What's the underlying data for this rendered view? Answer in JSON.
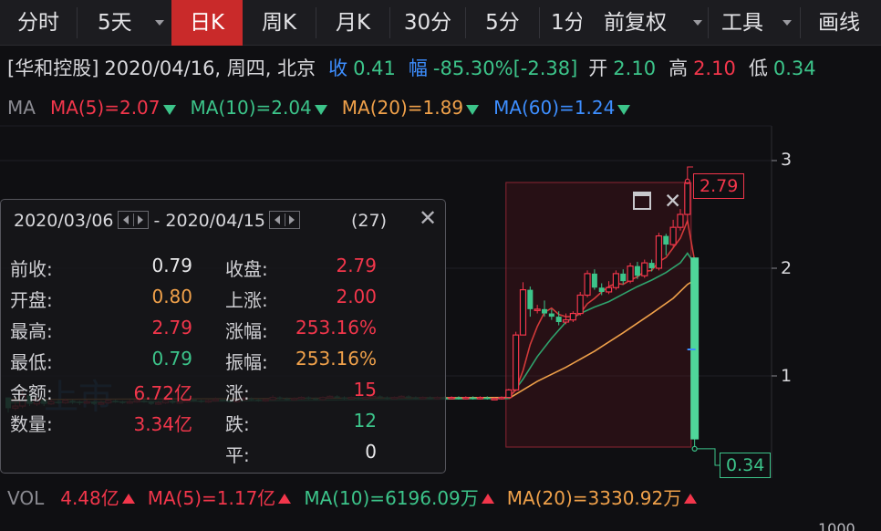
{
  "toolbar": {
    "buttons": [
      "分时",
      "5天",
      "日K",
      "周K",
      "月K",
      "30分",
      "5分",
      "1分",
      "前复权",
      "工具",
      "画线"
    ],
    "active": "日K"
  },
  "info": {
    "name": "[华和控股]",
    "datetime": "2020/04/16, 周四, 北京",
    "close_label": "收",
    "close_value": "0.41",
    "change_label": "幅",
    "change_value": "-85.30%",
    "change_abs": "[-2.38]",
    "open_label": "开",
    "open_value": "2.10",
    "high_label": "高",
    "high_value": "2.10",
    "low_label": "低",
    "low_value": "0.34"
  },
  "ma": {
    "label": "MA",
    "ma5": "MA(5)=2.07",
    "ma10": "MA(10)=2.04",
    "ma20": "MA(20)=1.89",
    "ma60": "MA(60)=1.24"
  },
  "popup": {
    "date_from": "2020/03/06",
    "date_to": "2020/04/15",
    "separator": "-",
    "count": "(27)",
    "rows": [
      {
        "l1": "前收:",
        "v1": "0.79",
        "c1": "#e8e8ea",
        "l2": "收盘:",
        "v2": "2.79",
        "c2": "#f2364b"
      },
      {
        "l1": "开盘:",
        "v1": "0.80",
        "c1": "#f0a14a",
        "l2": "上涨:",
        "v2": "2.00",
        "c2": "#f2364b"
      },
      {
        "l1": "最高:",
        "v1": "2.79",
        "c1": "#f2364b",
        "l2": "涨幅:",
        "v2": "253.16%",
        "c2": "#f2364b"
      },
      {
        "l1": "最低:",
        "v1": "0.79",
        "c1": "#3cc48a",
        "l2": "振幅:",
        "v2": "253.16%",
        "c2": "#f0a14a"
      },
      {
        "l1": "金额:",
        "v1": "6.72亿",
        "c1": "#f2364b",
        "l2": "涨:",
        "v2": "15",
        "c2": "#f2364b"
      },
      {
        "l1": "数量:",
        "v1": "3.34亿",
        "c1": "#f2364b",
        "l2": "跌:",
        "v2": "12",
        "c2": "#3cc48a"
      },
      {
        "l1": "",
        "v1": "",
        "c1": "#e8e8ea",
        "l2": "平:",
        "v2": "0",
        "c2": "#e8e8ea"
      }
    ]
  },
  "watermark": "上市",
  "vol": {
    "label": "VOL",
    "vol": "4.48亿",
    "ma5": "MA(5)=1.17亿",
    "ma10": "MA(10)=6196.09万",
    "ma20": "MA(20)=3330.92万"
  },
  "corner_text": "1000",
  "chart_data": {
    "type": "candlestick",
    "y_ticks": [
      "3",
      "2",
      "1"
    ],
    "y_tick_values": [
      3,
      2,
      1
    ],
    "ylim": [
      0.15,
      3.35
    ],
    "selection": {
      "from_index": 70,
      "to_index": 96,
      "max_label": "2.79",
      "min_label": "0.34"
    },
    "candles": [
      [
        0.8,
        0.7,
        0.8,
        0.66
      ],
      [
        0.7,
        0.72,
        0.76,
        0.68
      ],
      [
        0.72,
        0.82,
        0.86,
        0.7
      ],
      [
        0.82,
        0.74,
        0.84,
        0.72
      ],
      [
        0.74,
        0.78,
        0.8,
        0.72
      ],
      [
        0.78,
        0.74,
        0.8,
        0.72
      ],
      [
        0.74,
        0.76,
        0.78,
        0.73
      ],
      [
        0.76,
        0.75,
        0.78,
        0.74
      ],
      [
        0.75,
        0.77,
        0.79,
        0.74
      ],
      [
        0.77,
        0.76,
        0.78,
        0.74
      ],
      [
        0.76,
        0.75,
        0.77,
        0.73
      ],
      [
        0.75,
        0.76,
        0.78,
        0.74
      ],
      [
        0.76,
        0.74,
        0.77,
        0.73
      ],
      [
        0.74,
        0.75,
        0.77,
        0.73
      ],
      [
        0.75,
        0.77,
        0.78,
        0.74
      ],
      [
        0.77,
        0.76,
        0.78,
        0.75
      ],
      [
        0.76,
        0.75,
        0.77,
        0.74
      ],
      [
        0.75,
        0.76,
        0.78,
        0.74
      ],
      [
        0.76,
        0.77,
        0.78,
        0.75
      ],
      [
        0.77,
        0.76,
        0.78,
        0.75
      ],
      [
        0.76,
        0.74,
        0.77,
        0.73
      ],
      [
        0.74,
        0.75,
        0.77,
        0.73
      ],
      [
        0.75,
        0.77,
        0.79,
        0.74
      ],
      [
        0.77,
        0.75,
        0.78,
        0.74
      ],
      [
        0.75,
        0.76,
        0.77,
        0.74
      ],
      [
        0.76,
        0.78,
        0.79,
        0.75
      ],
      [
        0.78,
        0.77,
        0.79,
        0.76
      ],
      [
        0.77,
        0.76,
        0.78,
        0.75
      ],
      [
        0.76,
        0.77,
        0.78,
        0.75
      ],
      [
        0.77,
        0.78,
        0.8,
        0.76
      ],
      [
        0.78,
        0.77,
        0.79,
        0.76
      ],
      [
        0.77,
        0.76,
        0.78,
        0.75
      ],
      [
        0.76,
        0.78,
        0.8,
        0.75
      ],
      [
        0.78,
        0.79,
        0.81,
        0.77
      ],
      [
        0.79,
        0.78,
        0.8,
        0.77
      ],
      [
        0.78,
        0.77,
        0.79,
        0.76
      ],
      [
        0.77,
        0.78,
        0.79,
        0.76
      ],
      [
        0.78,
        0.8,
        0.82,
        0.77
      ],
      [
        0.8,
        0.79,
        0.81,
        0.78
      ],
      [
        0.79,
        0.78,
        0.8,
        0.77
      ],
      [
        0.78,
        0.79,
        0.8,
        0.77
      ],
      [
        0.79,
        0.8,
        0.81,
        0.78
      ],
      [
        0.8,
        0.79,
        0.81,
        0.78
      ],
      [
        0.79,
        0.78,
        0.8,
        0.77
      ],
      [
        0.78,
        0.8,
        0.81,
        0.77
      ],
      [
        0.8,
        0.81,
        0.82,
        0.79
      ],
      [
        0.81,
        0.8,
        0.82,
        0.79
      ],
      [
        0.8,
        0.79,
        0.81,
        0.78
      ],
      [
        0.79,
        0.8,
        0.81,
        0.78
      ],
      [
        0.8,
        0.79,
        0.81,
        0.78
      ],
      [
        0.79,
        0.8,
        0.81,
        0.78
      ],
      [
        0.8,
        0.81,
        0.82,
        0.79
      ],
      [
        0.81,
        0.8,
        0.82,
        0.79
      ],
      [
        0.8,
        0.79,
        0.81,
        0.78
      ],
      [
        0.79,
        0.8,
        0.81,
        0.78
      ],
      [
        0.8,
        0.81,
        0.82,
        0.79
      ],
      [
        0.81,
        0.8,
        0.82,
        0.79
      ],
      [
        0.8,
        0.79,
        0.81,
        0.78
      ],
      [
        0.79,
        0.8,
        0.81,
        0.78
      ],
      [
        0.8,
        0.79,
        0.81,
        0.78
      ],
      [
        0.79,
        0.8,
        0.81,
        0.78
      ],
      [
        0.8,
        0.79,
        0.81,
        0.78
      ],
      [
        0.79,
        0.8,
        0.81,
        0.78
      ],
      [
        0.8,
        0.79,
        0.81,
        0.78
      ],
      [
        0.79,
        0.8,
        0.81,
        0.78
      ],
      [
        0.8,
        0.79,
        0.81,
        0.78
      ],
      [
        0.79,
        0.8,
        0.81,
        0.78
      ],
      [
        0.8,
        0.79,
        0.81,
        0.78
      ],
      [
        0.79,
        0.79,
        0.8,
        0.78
      ],
      [
        0.79,
        0.8,
        0.81,
        0.78
      ],
      [
        0.8,
        0.87,
        0.88,
        0.79
      ],
      [
        0.87,
        1.38,
        1.41,
        0.86
      ],
      [
        1.38,
        1.8,
        1.87,
        1.38
      ],
      [
        1.8,
        1.62,
        1.83,
        1.55
      ],
      [
        1.62,
        1.62,
        1.66,
        1.58
      ],
      [
        1.62,
        1.58,
        1.7,
        1.55
      ],
      [
        1.58,
        1.55,
        1.62,
        1.52
      ],
      [
        1.55,
        1.5,
        1.6,
        1.47
      ],
      [
        1.5,
        1.52,
        1.58,
        1.48
      ],
      [
        1.52,
        1.58,
        1.6,
        1.5
      ],
      [
        1.58,
        1.75,
        1.78,
        1.56
      ],
      [
        1.75,
        1.95,
        1.98,
        1.73
      ],
      [
        1.95,
        1.82,
        1.99,
        1.8
      ],
      [
        1.82,
        1.78,
        1.86,
        1.75
      ],
      [
        1.78,
        1.82,
        1.88,
        1.76
      ],
      [
        1.82,
        1.95,
        1.98,
        1.8
      ],
      [
        1.95,
        1.88,
        1.99,
        1.85
      ],
      [
        1.88,
        2.02,
        2.05,
        1.86
      ],
      [
        2.02,
        1.93,
        2.06,
        1.9
      ],
      [
        1.93,
        2.05,
        2.08,
        1.91
      ],
      [
        2.05,
        2.0,
        2.08,
        1.97
      ],
      [
        2.0,
        2.3,
        2.33,
        1.98
      ],
      [
        2.3,
        2.22,
        2.32,
        2.12
      ],
      [
        2.22,
        2.38,
        2.45,
        2.2
      ],
      [
        2.38,
        2.5,
        2.55,
        2.35
      ],
      [
        2.5,
        2.79,
        2.79,
        2.42
      ],
      [
        2.1,
        0.41,
        2.1,
        0.34
      ]
    ],
    "ma5": [
      [
        70,
        0.8
      ],
      [
        71,
        0.87
      ],
      [
        72,
        1.05
      ],
      [
        73,
        1.29
      ],
      [
        74,
        1.46
      ],
      [
        75,
        1.59
      ],
      [
        76,
        1.63
      ],
      [
        77,
        1.57
      ],
      [
        78,
        1.55
      ],
      [
        79,
        1.55
      ],
      [
        80,
        1.58
      ],
      [
        81,
        1.67
      ],
      [
        82,
        1.72
      ],
      [
        83,
        1.78
      ],
      [
        84,
        1.83
      ],
      [
        85,
        1.86
      ],
      [
        86,
        1.85
      ],
      [
        87,
        1.89
      ],
      [
        88,
        1.92
      ],
      [
        89,
        1.97
      ],
      [
        90,
        1.98
      ],
      [
        91,
        2.06
      ],
      [
        92,
        2.1
      ],
      [
        93,
        2.19
      ],
      [
        94,
        2.28
      ],
      [
        95,
        2.44
      ],
      [
        96,
        2.07
      ]
    ],
    "ma10": [
      [
        70,
        0.79
      ],
      [
        72,
        0.97
      ],
      [
        74,
        1.18
      ],
      [
        76,
        1.35
      ],
      [
        78,
        1.5
      ],
      [
        80,
        1.58
      ],
      [
        82,
        1.64
      ],
      [
        84,
        1.69
      ],
      [
        86,
        1.76
      ],
      [
        88,
        1.83
      ],
      [
        90,
        1.89
      ],
      [
        92,
        1.96
      ],
      [
        94,
        2.05
      ],
      [
        95,
        2.14
      ],
      [
        96,
        2.04
      ]
    ],
    "ma20": [
      [
        70,
        0.79
      ],
      [
        74,
        0.95
      ],
      [
        78,
        1.08
      ],
      [
        82,
        1.23
      ],
      [
        86,
        1.4
      ],
      [
        90,
        1.58
      ],
      [
        93,
        1.72
      ],
      [
        95,
        1.85
      ],
      [
        96,
        1.89
      ]
    ]
  }
}
